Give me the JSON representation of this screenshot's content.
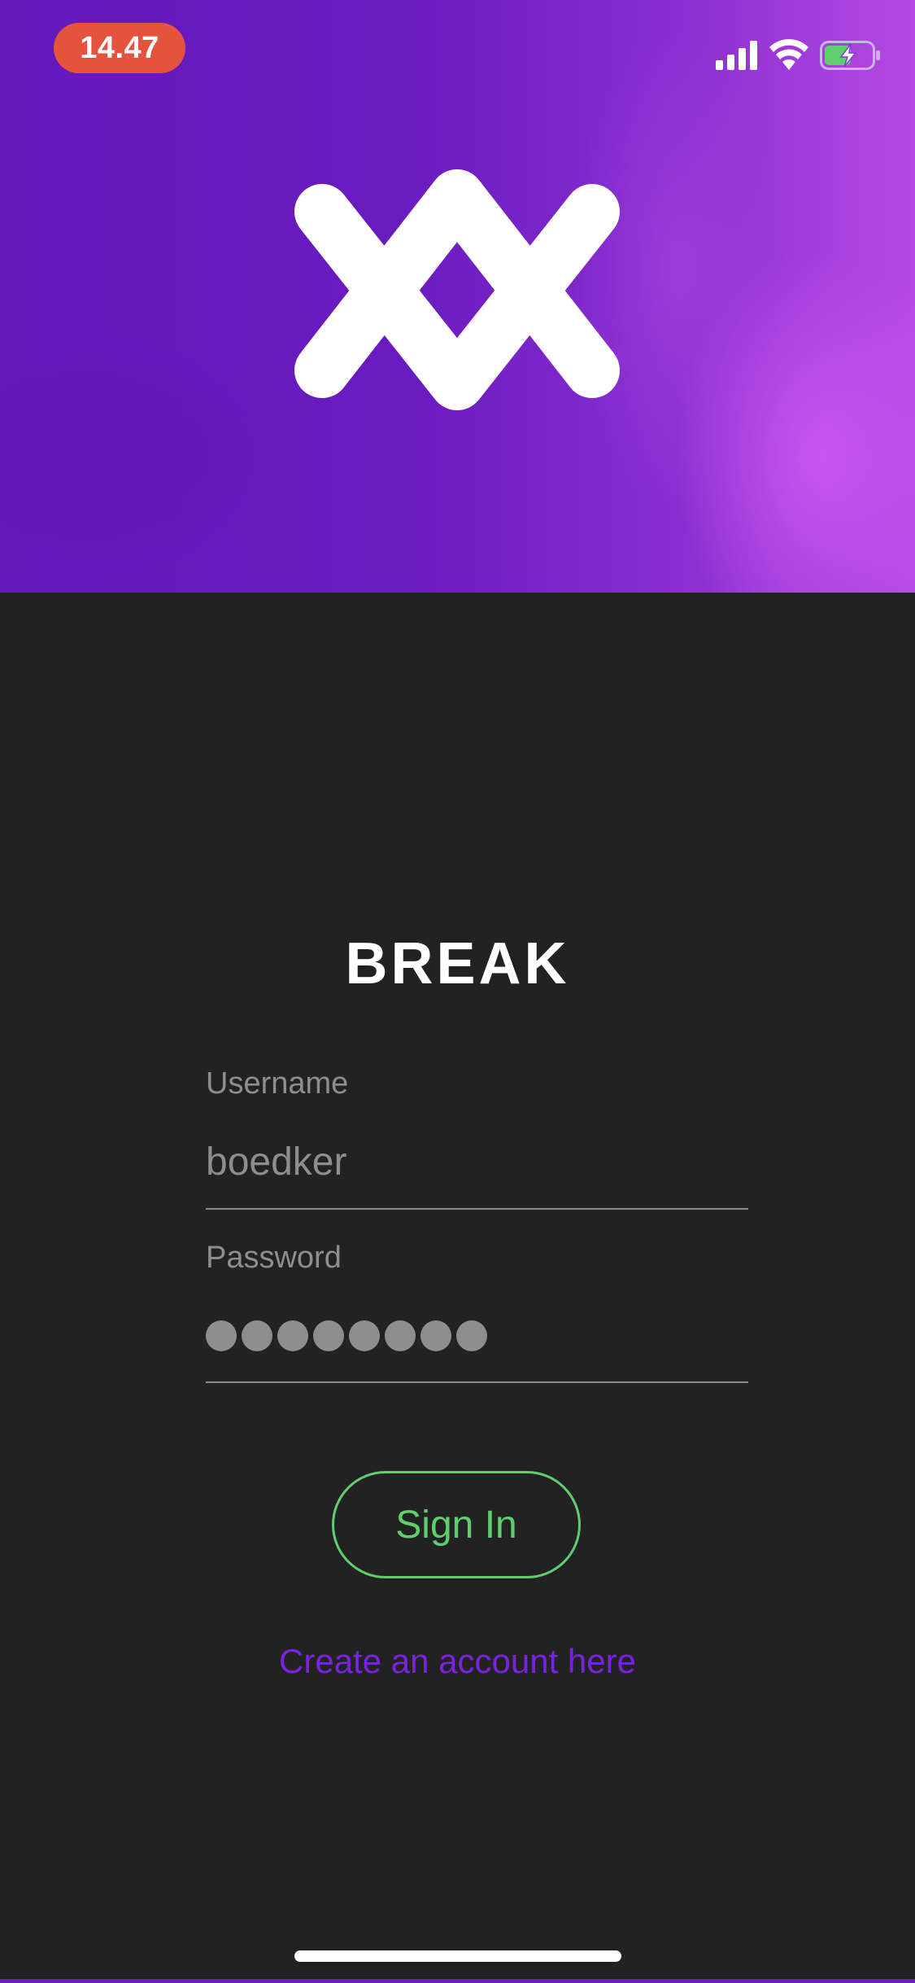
{
  "status_bar": {
    "time": "14.47",
    "time_pill_color": "#e5533f",
    "icons": [
      "signal-icon",
      "wifi-icon",
      "battery-charging-icon"
    ]
  },
  "hero": {
    "logo_icon": "break-x-logo-icon",
    "gradient_colors": [
      "#6419bd",
      "#b64ae3"
    ]
  },
  "brand": {
    "name": "BREAK"
  },
  "login_form": {
    "username_label": "Username",
    "username_value": "boedker",
    "password_label": "Password",
    "password_mask_count": 8,
    "sign_in_label": "Sign In",
    "create_account_label": "Create an account here"
  },
  "colors": {
    "background": "#222222",
    "accent_green": "#5fcf6e",
    "accent_purple": "#7a22df",
    "muted_text": "#8e8e8e"
  }
}
